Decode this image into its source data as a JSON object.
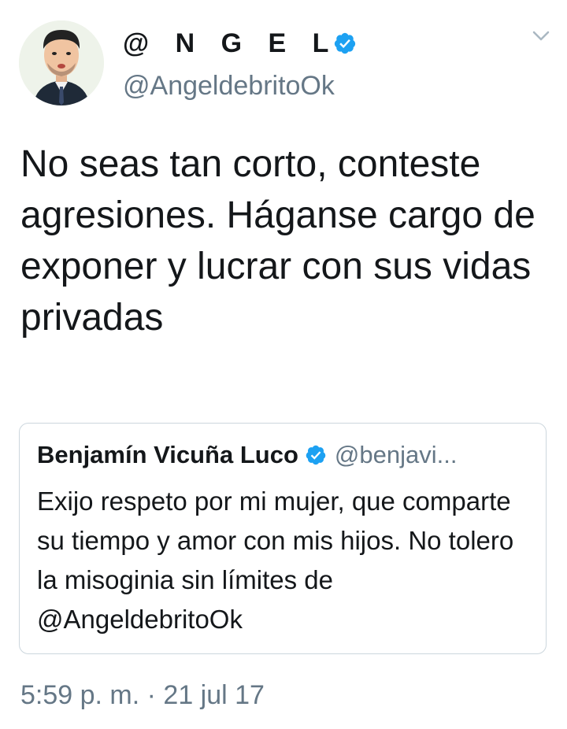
{
  "author": {
    "display_name": "@ N G E L",
    "handle": "@AngeldebritoOk",
    "verified": true
  },
  "tweet": {
    "text": "No seas tan corto, conteste agresiones. Háganse cargo de exponer y lucrar con sus vidas privadas"
  },
  "quoted_tweet": {
    "author_name": "Benjamín Vicuña Luco",
    "author_handle": "@benjavi...",
    "verified": true,
    "text": "Exijo respeto por mi mujer, que comparte su tiempo y amor con mis hijos. No tolero la misoginia sin límites de @AngeldebritoOk"
  },
  "meta": {
    "timestamp": "5:59 p. m. · 21 jul 17"
  },
  "icons": {
    "verified": "verified-badge-icon",
    "menu": "chevron-down-icon",
    "avatar": "avatar"
  },
  "colors": {
    "verified_blue": "#1da1f2",
    "secondary_text": "#657786",
    "border": "#ccd6dd"
  }
}
